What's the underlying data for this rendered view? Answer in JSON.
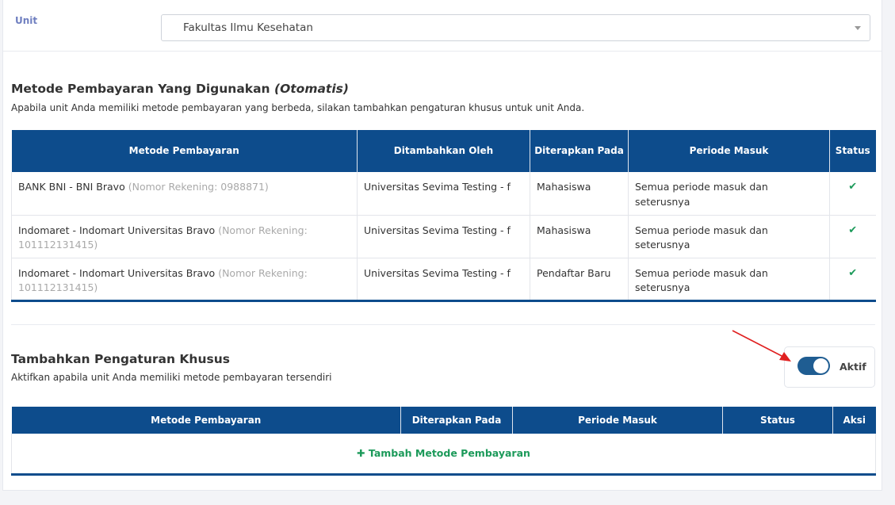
{
  "unit": {
    "label": "Unit",
    "selected": "Fakultas Ilmu Kesehatan"
  },
  "auto_section": {
    "title": "Metode Pembayaran Yang Digunakan",
    "title_em": "(Otomatis)",
    "description": "Apabila unit Anda memiliki metode pembayaran yang berbeda, silakan tambahkan pengaturan khusus untuk unit Anda.",
    "headers": [
      "Metode Pembayaran",
      "Ditambahkan Oleh",
      "Diterapkan Pada",
      "Periode Masuk",
      "Status"
    ],
    "rows": [
      {
        "method": "BANK BNI - BNI Bravo",
        "account": "(Nomor Rekening: 0988871)",
        "added_by": "Universitas Sevima Testing - f",
        "applied_to": "Mahasiswa",
        "period": "Semua periode masuk dan seterusnya",
        "status_icon": "check-icon"
      },
      {
        "method": "Indomaret - Indomart Universitas Bravo",
        "account": "(Nomor Rekening: 101112131415)",
        "added_by": "Universitas Sevima Testing - f",
        "applied_to": "Mahasiswa",
        "period": "Semua periode masuk dan seterusnya",
        "status_icon": "check-icon"
      },
      {
        "method": "Indomaret - Indomart Universitas Bravo",
        "account": "(Nomor Rekening: 101112131415)",
        "added_by": "Universitas Sevima Testing - f",
        "applied_to": "Pendaftar Baru",
        "period": "Semua periode masuk dan seterusnya",
        "status_icon": "check-icon"
      }
    ]
  },
  "custom_section": {
    "title": "Tambahkan Pengaturan Khusus",
    "description": "Aktifkan apabila unit Anda memiliki metode pembayaran tersendiri",
    "toggle_label": "Aktif",
    "toggle_on": true,
    "headers": [
      "Metode Pembayaran",
      "Diterapkan Pada",
      "Periode Masuk",
      "Status",
      "Aksi"
    ],
    "add_label": "Tambah Metode Pembayaran"
  },
  "colors": {
    "header_bg": "#0d4c8c",
    "success": "#1c9a5a",
    "toggle": "#1f5d92",
    "annotation_arrow": "#e02020"
  }
}
